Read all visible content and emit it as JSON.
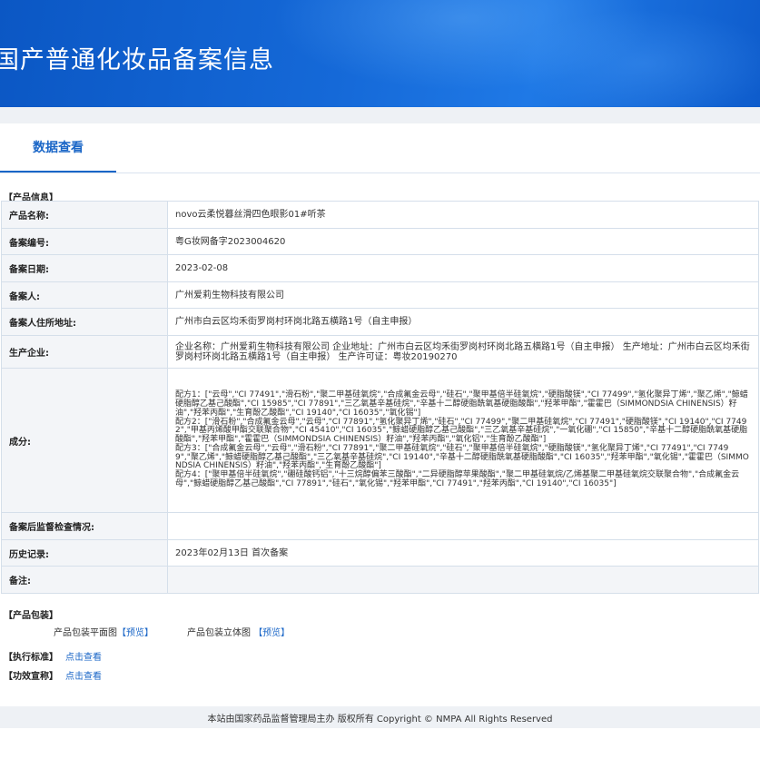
{
  "header": {
    "title": "国产普通化妆品备案信息"
  },
  "tabs": {
    "active_label": "数据查看"
  },
  "product_info": {
    "section_label": "【产品信息】",
    "rows": [
      {
        "key": "产品名称:",
        "value": "novo云柔悦暮丝滑四色眼影01#听茶"
      },
      {
        "key": "备案编号:",
        "value": "粤G妆网备字2023004620"
      },
      {
        "key": "备案日期:",
        "value": "2023-02-08"
      },
      {
        "key": "备案人:",
        "value": "广州爱莉生物科技有限公司"
      },
      {
        "key": "备案人住所地址:",
        "value": "广州市白云区均禾街罗岗村环岗北路五横路1号（自主申报）"
      },
      {
        "key": "生产企业:",
        "value": "企业名称：广州爱莉生物科技有限公司 企业地址：广州市白云区均禾街罗岗村环岗北路五横路1号（自主申报） 生产地址：广州市白云区均禾街罗岗村环岗北路五横路1号（自主申报） 生产许可证：粤妆20190270"
      },
      {
        "key": "成分:",
        "value": [
          "配方1：[\"云母\",\"CI 77491\",\"滑石粉\",\"聚二甲基硅氧烷\",\"合成氟金云母\",\"硅石\",\"聚甲基倍半硅氧烷\",\"硬脂酸镁\",\"CI 77499\",\"氢化聚异丁烯\",\"聚乙烯\",\"鲸蜡硬脂醇乙基己酸酯\",\"CI 15985\",\"CI 77891\",\"三乙氧基辛基硅烷\",\"辛基十二醇硬脂酰氧基硬脂酸酯\",\"羟苯甲酯\",\"霍霍巴（SIMMONDSIA CHINENSIS）籽油\",\"羟苯丙酯\",\"生育酚乙酸酯\",\"CI 19140\",\"CI 16035\",\"氧化锡\"]",
          "配方2：[\"滑石粉\",\"合成氟金云母\",\"云母\",\"CI 77891\",\"氢化聚异丁烯\",\"硅石\",\"CI 77499\",\"聚二甲基硅氧烷\",\"CI 77491\",\"硬脂酸镁\",\"CI 19140\",\"CI 77492\",\"甲基丙烯酸甲酯交联聚合物\",\"CI 45410\",\"CI 16035\",\"鲸蜡硬脂醇乙基己酸酯\",\"三乙氧基辛基硅烷\",\"一氧化硼\",\"CI 15850\",\"辛基十二醇硬脂酰氧基硬脂酸酯\",\"羟苯甲酯\",\"霍霍巴（SIMMONDSIA CHINENSIS）籽油\",\"羟苯丙酯\",\"氧化铝\",\"生育酚乙酸酯\"]",
          "配方3：[\"合成氟金云母\",\"云母\",\"滑石粉\",\"CI 77891\",\"聚二甲基硅氧烷\",\"硅石\",\"聚甲基倍半硅氧烷\",\"硬脂酸镁\",\"氢化聚异丁烯\",\"CI 77491\",\"CI 77499\",\"聚乙烯\",\"鲸蜡硬脂醇乙基己酸酯\",\"三乙氧基辛基硅烷\",\"CI 19140\",\"辛基十二醇硬脂酰氧基硬脂酸酯\",\"CI 16035\",\"羟苯甲酯\",\"氧化锡\",\"霍霍巴（SIMMONDSIA CHINENSIS）籽油\",\"羟苯丙酯\",\"生育酚乙酸酯\"]",
          "配方4：[\"聚甲基倍半硅氧烷\",\"硼硅酸钙铝\",\"十三烷醇偏苯三酸酯\",\"二异硬脂醇苹果酸酯\",\"聚二甲基硅氧烷/乙烯基聚二甲基硅氧烷交联聚合物\",\"合成氟金云母\",\"鲸蜡硬脂醇乙基己酸酯\",\"CI 77891\",\"硅石\",\"氧化锡\",\"羟苯甲酯\",\"CI 77491\",\"羟苯丙酯\",\"CI 19140\",\"CI 16035\"]"
        ]
      },
      {
        "key": "备案后监督检查情况:",
        "value": ""
      },
      {
        "key": "历史记录:",
        "value": "2023年02月13日 首次备案"
      },
      {
        "key": "备注:",
        "value": ""
      }
    ]
  },
  "packaging": {
    "section_label": "【产品包装】",
    "flat_label": "产品包装平面图",
    "flat_link": "【预览】",
    "stereo_label": "产品包装立体图",
    "stereo_link": "【预览】"
  },
  "standard": {
    "label": "【执行标准】",
    "link": "点击查看"
  },
  "efficacy": {
    "label": "【功效宣称】",
    "link": "点击查看"
  },
  "footer": {
    "text": "本站由国家药品监督管理局主办 版权所有 Copyright © NMPA All Rights Reserved"
  },
  "colors": {
    "banner": "#1569d8",
    "accent": "#1a66c7",
    "band": "#eef1f5"
  }
}
